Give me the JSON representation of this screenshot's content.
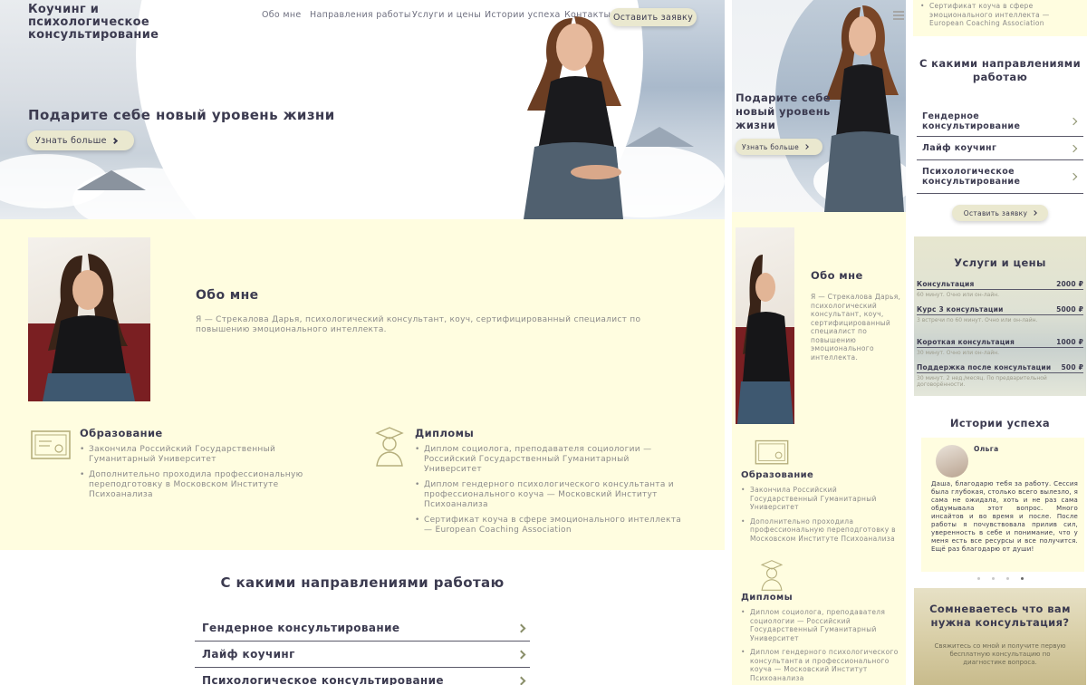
{
  "site": {
    "brand": "Коучинг и психологическое консультирование",
    "nav": [
      "Обо мне",
      "Направления работы",
      "Услуги и цены",
      "Истории успеха",
      "Контакты"
    ],
    "cta": "Оставить заявку"
  },
  "hero": {
    "title": "Подарите себе новый уровень жизни",
    "more": "Узнать больше"
  },
  "about": {
    "title": "Обо мне",
    "text": "Я — Стрекалова Дарья, психологический консультант, коуч, сертифицированный специалист по повышению эмоционального интеллекта."
  },
  "education": {
    "title": "Образование",
    "items": [
      "Закончила Российский Государственный Гуманитарный Университет",
      "Дополнительно проходила профессиональную переподготовку в Московском Институте Психоанализа"
    ]
  },
  "diplomas": {
    "title": "Дипломы",
    "items": [
      "Диплом социолога, преподавателя социологии — Российский Государственный Гуманитарный Университет",
      "Диплом гендерного психологического консультанта и профессионального коуча — Московский Институт Психоанализа",
      "Сертификат коуча в сфере эмоционального интеллекта — European Coaching Association"
    ]
  },
  "directions": {
    "title": "С какими направлениями работаю",
    "items": [
      "Гендерное консультирование",
      "Лайф коучинг",
      "Психологическое консультирование"
    ]
  },
  "prices": {
    "title": "Услуги и цены",
    "items": [
      {
        "name": "Консультация",
        "price": "2000 ₽",
        "note": "60 минут. Очно или он-лайн."
      },
      {
        "name": "Курс 3 консультации",
        "price": "5000 ₽",
        "note": "3 встречи по 60 минут. Очно или он-лайн."
      },
      {
        "name": "Короткая консультация",
        "price": "1000 ₽",
        "note": "30 минут. Очно или он-лайн."
      },
      {
        "name": "Поддержка после консультации",
        "price": "500 ₽",
        "note": "30 минут. 2 нед./месяц. По предварительной договорённости."
      }
    ]
  },
  "stories": {
    "title": "Истории успеха",
    "name": "Ольга",
    "text": "Даша, благодарю тебя за работу. Сессия была глубокая, столько всего вылезло, я сама не ожидала, хоть и не раз сама обдумывала этот вопрос. Много инсайтов и во время и после. После работы я почувствовала прилив сил, уверенность в себе и понимание, что у меня есть все ресурсы и все получится. Ещё раз благодарю от души!",
    "dots": 4,
    "active_dot": 4
  },
  "doubt": {
    "title": "Сомневаетесь что вам нужна консультация?",
    "text": "Свяжитесь со мной и получите первую бесплатную консультацию по диагностике вопроса."
  }
}
